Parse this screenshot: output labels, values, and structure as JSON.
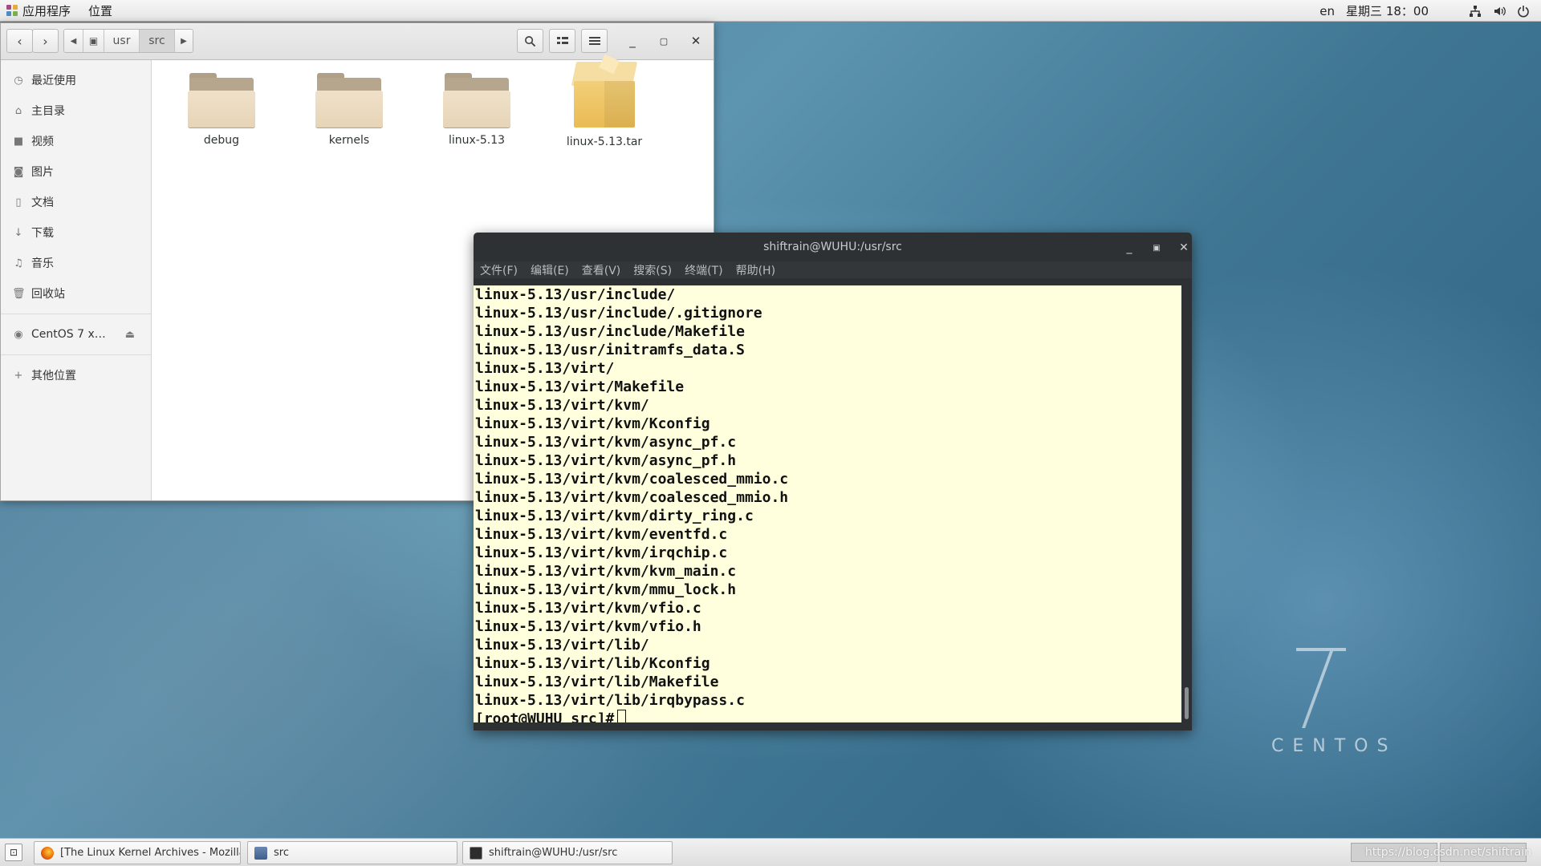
{
  "top_panel": {
    "applications": "应用程序",
    "places": "位置",
    "input_method": "en",
    "clock": "星期三 18：00"
  },
  "files": {
    "path": [
      "usr",
      "src"
    ],
    "sidebar": [
      {
        "label": "最近使用",
        "icon": "clock-icon"
      },
      {
        "label": "主目录",
        "icon": "home-icon"
      },
      {
        "label": "视频",
        "icon": "video-icon"
      },
      {
        "label": "图片",
        "icon": "camera-icon"
      },
      {
        "label": "文档",
        "icon": "document-icon"
      },
      {
        "label": "下载",
        "icon": "download-icon"
      },
      {
        "label": "音乐",
        "icon": "music-icon"
      },
      {
        "label": "回收站",
        "icon": "trash-icon"
      }
    ],
    "device": {
      "label": "CentOS 7 x…",
      "icon": "disc-icon"
    },
    "other_locations": "其他位置",
    "items": [
      {
        "name": "debug",
        "type": "folder"
      },
      {
        "name": "kernels",
        "type": "folder"
      },
      {
        "name": "linux-5.13",
        "type": "folder"
      },
      {
        "name": "linux-5.13.tar",
        "type": "archive"
      }
    ]
  },
  "terminal": {
    "title": "shiftrain@WUHU:/usr/src",
    "menu": [
      "文件(F)",
      "编辑(E)",
      "查看(V)",
      "搜索(S)",
      "终端(T)",
      "帮助(H)"
    ],
    "lines": [
      "linux-5.13/usr/include/",
      "linux-5.13/usr/include/.gitignore",
      "linux-5.13/usr/include/Makefile",
      "linux-5.13/usr/initramfs_data.S",
      "linux-5.13/virt/",
      "linux-5.13/virt/Makefile",
      "linux-5.13/virt/kvm/",
      "linux-5.13/virt/kvm/Kconfig",
      "linux-5.13/virt/kvm/async_pf.c",
      "linux-5.13/virt/kvm/async_pf.h",
      "linux-5.13/virt/kvm/coalesced_mmio.c",
      "linux-5.13/virt/kvm/coalesced_mmio.h",
      "linux-5.13/virt/kvm/dirty_ring.c",
      "linux-5.13/virt/kvm/eventfd.c",
      "linux-5.13/virt/kvm/irqchip.c",
      "linux-5.13/virt/kvm/kvm_main.c",
      "linux-5.13/virt/kvm/mmu_lock.h",
      "linux-5.13/virt/kvm/vfio.c",
      "linux-5.13/virt/kvm/vfio.h",
      "linux-5.13/virt/lib/",
      "linux-5.13/virt/lib/Kconfig",
      "linux-5.13/virt/lib/Makefile",
      "linux-5.13/virt/lib/irqbypass.c"
    ],
    "prompt": "[root@WUHU src]#"
  },
  "desktop": {
    "brand_number": "7",
    "brand_word": "CENTOS"
  },
  "taskbar": {
    "tasks": [
      {
        "label": "[The Linux Kernel Archives - Mozilla…",
        "icon": "firefox-icon"
      },
      {
        "label": "src",
        "icon": "file-manager-icon"
      },
      {
        "label": "shiftrain@WUHU:/usr/src",
        "icon": "terminal-icon"
      }
    ],
    "watermark": "https://blog.csdn.net/shiftrain"
  }
}
